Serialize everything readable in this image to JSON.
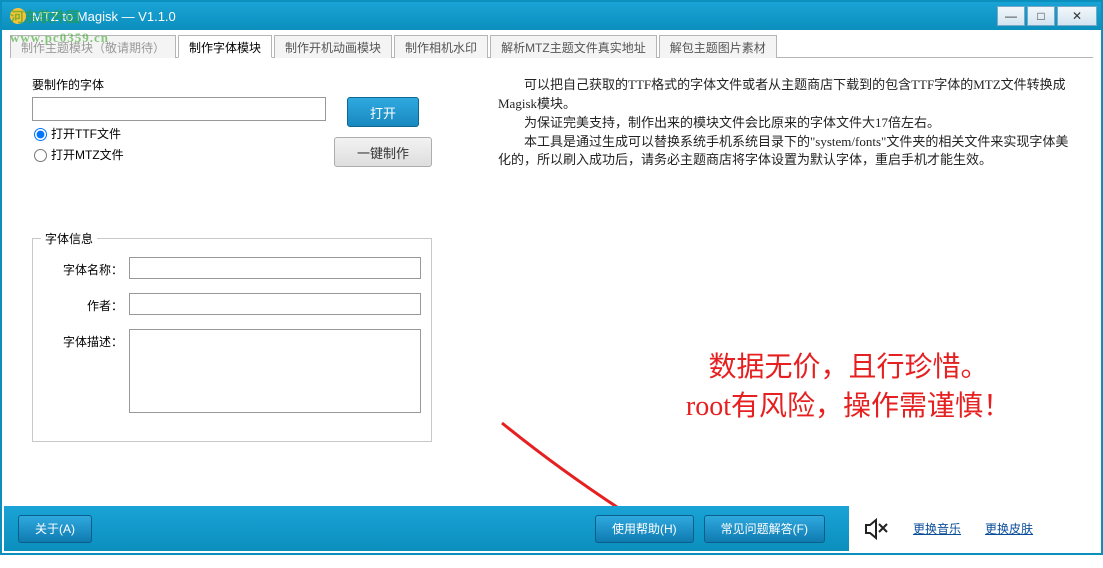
{
  "window": {
    "title": "MTZ to Magisk — V1.1.0"
  },
  "watermark": {
    "line1": "河东软件园",
    "line2": "www.pc0359.cn"
  },
  "tabs": [
    {
      "label": "制作主题模块（敬请期待）",
      "active": false,
      "disabled": true
    },
    {
      "label": "制作字体模块",
      "active": true,
      "disabled": false
    },
    {
      "label": "制作开机动画模块",
      "active": false,
      "disabled": false
    },
    {
      "label": "制作相机水印",
      "active": false,
      "disabled": false
    },
    {
      "label": "解析MTZ主题文件真实地址",
      "active": false,
      "disabled": false
    },
    {
      "label": "解包主题图片素材",
      "active": false,
      "disabled": false
    }
  ],
  "panel": {
    "section_label": "要制作的字体",
    "open_btn": "打开",
    "make_btn": "一键制作",
    "radio_ttf": "打开TTF文件",
    "radio_mtz": "打开MTZ文件",
    "file_value": ""
  },
  "fontinfo": {
    "legend": "字体信息",
    "name_label": "字体名称：",
    "author_label": "作者：",
    "desc_label": "字体描述：",
    "name_value": "",
    "author_value": "",
    "desc_value": ""
  },
  "instructions": {
    "p1": "可以把自己获取的TTF格式的字体文件或者从主题商店下载到的包含TTF字体的MTZ文件转换成Magisk模块。",
    "p2": "为保证完美支持，制作出来的模块文件会比原来的字体文件大17倍左右。",
    "p3": "本工具是通过生成可以替换系统手机系统目录下的\"system/fonts\"文件夹的相关文件来实现字体美化的，所以刷入成功后，请务必主题商店将字体设置为默认字体，重启手机才能生效。"
  },
  "warning": {
    "line1": "数据无价，且行珍惜。",
    "line2": "root有风险，操作需谨慎！"
  },
  "footer": {
    "about": "关于(A)",
    "help": "使用帮助(H)",
    "faq": "常见问题解答(F)",
    "change_music": "更换音乐",
    "change_skin": "更换皮肤"
  },
  "icons": {
    "minimize": "—",
    "maximize": "□",
    "close": "✕"
  }
}
